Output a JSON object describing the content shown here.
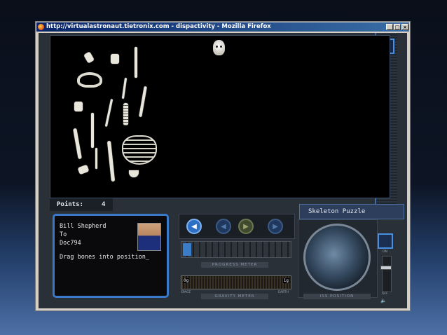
{
  "window": {
    "title": "http://virtualastronaut.tietronix.com - dispactivity - Mozilla Firefox",
    "buttons": {
      "minimize": "_",
      "maximize": "□",
      "close": "×"
    }
  },
  "game": {
    "points_label": "Points:",
    "points_value": "4",
    "panel_title": "Skeleton Puzzle",
    "message": {
      "from": "Bill Shepherd",
      "to_label": "To",
      "to": "Doc794",
      "text": "Drag bones into position_"
    },
    "progress_label": "PROGRESS METER",
    "progress": 0.08,
    "gravity_label": "GRAVITY METER",
    "gravity_min": "0g",
    "gravity_max": "1g",
    "gravity_left": "SPACE",
    "gravity_right": "EARTH",
    "iss_label": "ISS POSITION",
    "slider_top": "ON",
    "slider_bottom": "OFF",
    "slider_value": 0.3
  },
  "colors": {
    "accent": "#3a78c8",
    "viewport": "#000000"
  },
  "icons": [
    "firefox-icon",
    "hand-icon",
    "rewind-icon",
    "back-icon",
    "play-icon",
    "forward-icon",
    "globe-icon",
    "speaker-icon"
  ]
}
